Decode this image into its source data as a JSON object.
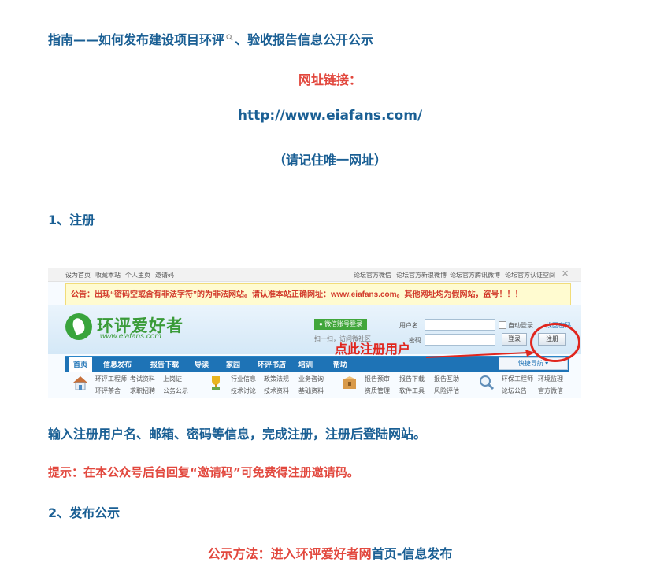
{
  "article": {
    "heading_part1": "指南——如何发布",
    "heading_part2": "建设项目环评",
    "heading_icon": "magnifier-icon",
    "heading_part3": "、验收报告信息公开公示",
    "url_label": "网址链接：",
    "url": "http://www.eiafans.com/",
    "url_note": "（请记住唯一网址）",
    "step1_title": "1、注册",
    "step1_desc": "输入注册用户名、邮箱、密码等信息，完成注册，注册后登陆网站。",
    "tip": "提示：在本公众号后台回复“邀请码”可免费得注册邀请码。",
    "step2_title": "2、发布公示",
    "method_label": "公示方法：进入",
    "method_site": "环评爱好者网",
    "method_path": "首页-信息发布"
  },
  "screenshot": {
    "topbar_left": [
      "设为首页",
      "收藏本站",
      "个人主页",
      "邀请码"
    ],
    "topbar_right": [
      "论坛官方微信",
      "论坛官方新浪微博",
      "论坛官方腾讯微博",
      "论坛官方认证空间"
    ],
    "notice": "公告：出现“密码空或含有非法字符”的为非法网站。请认准本站正确网址：www.eiafans.com。其他网址均为假网站，盗号！！！",
    "logo_text": "环评爱好者",
    "logo_url": "www.eiafans.com",
    "wechat_login": "微信账号登录",
    "scan_text": "扫一扫，访问微社区",
    "username_label": "用户名",
    "auto_login": "自动登录",
    "forgot_password": "找回密码",
    "password_label": "密码",
    "login_button": "登录",
    "register_button": "注册",
    "annotation": "点此注册用户",
    "nav": [
      "首页",
      "信息发布",
      "报告下载",
      "导读",
      "家园",
      "环评书店",
      "培训",
      "帮助"
    ],
    "quick_nav": "快捷导航 ▾",
    "groups": [
      {
        "icon": "house-icon",
        "links": [
          "环评工程师",
          "考试资料",
          "上岗证",
          "环评茶舍",
          "求职招聘",
          "公务公示"
        ]
      },
      {
        "icon": "trophy-icon",
        "links": [
          "行业信息",
          "政策法规",
          "业务咨询",
          "技术讨论",
          "技术资料",
          "基础资料"
        ]
      },
      {
        "icon": "box-icon",
        "links": [
          "报告预审",
          "报告下载",
          "报告互助",
          "资质管理",
          "软件工具",
          "风险评估"
        ]
      },
      {
        "icon": "magnifier-icon",
        "links": [
          "环保工程师",
          "环境监理",
          "论坛公告",
          "官方微信"
        ]
      }
    ]
  },
  "colors": {
    "blue_text": "#1a5f94",
    "red_text": "#e2483e",
    "site_green": "#3a9b38",
    "nav_blue": "#1e73b6"
  }
}
